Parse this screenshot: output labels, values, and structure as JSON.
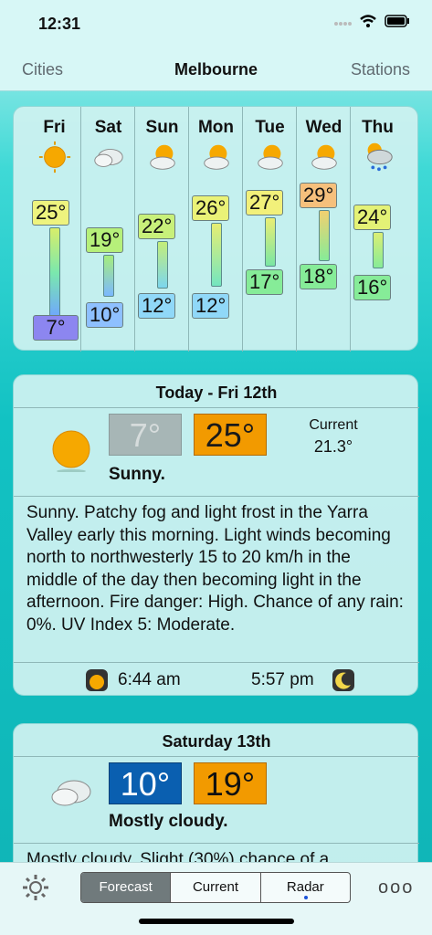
{
  "status": {
    "time": "12:31"
  },
  "nav": {
    "left": "Cities",
    "title": "Melbourne",
    "right": "Stations"
  },
  "week": [
    {
      "day": "Fri",
      "icon": "sunny-icon",
      "high": "25°",
      "low": "7°"
    },
    {
      "day": "Sat",
      "icon": "cloudy-icon",
      "high": "19°",
      "low": "10°"
    },
    {
      "day": "Sun",
      "icon": "partly-cloudy-icon",
      "high": "22°",
      "low": "12°"
    },
    {
      "day": "Mon",
      "icon": "partly-cloudy-icon",
      "high": "26°",
      "low": "12°"
    },
    {
      "day": "Tue",
      "icon": "partly-cloudy-icon",
      "high": "27°",
      "low": "17°"
    },
    {
      "day": "Wed",
      "icon": "partly-cloudy-icon",
      "high": "29°",
      "low": "18°"
    },
    {
      "day": "Thu",
      "icon": "rain-icon",
      "high": "24°",
      "low": "16°"
    }
  ],
  "today": {
    "heading": "Today - Fri 12th",
    "low": "7°",
    "high": "25°",
    "current_label": "Current",
    "current_value": "21.3°",
    "summary": "Sunny.",
    "description": "Sunny. Patchy fog and light frost in the Yarra Valley early this morning. Light winds becoming north to northwesterly 15 to 20 km/h in the middle of the day then becoming light in the afternoon. Fire danger: High. Chance of any rain: 0%. UV Index 5: Moderate.",
    "sunrise": "6:44 am",
    "sunset": "5:57 pm"
  },
  "saturday": {
    "heading": "Saturday 13th",
    "low": "10°",
    "high": "19°",
    "summary": "Mostly cloudy.",
    "description": "Mostly cloudy. Slight (30%) chance of a"
  },
  "tabs": {
    "forecast": "Forecast",
    "current": "Current",
    "radar": "Radar",
    "more": "ooo"
  }
}
